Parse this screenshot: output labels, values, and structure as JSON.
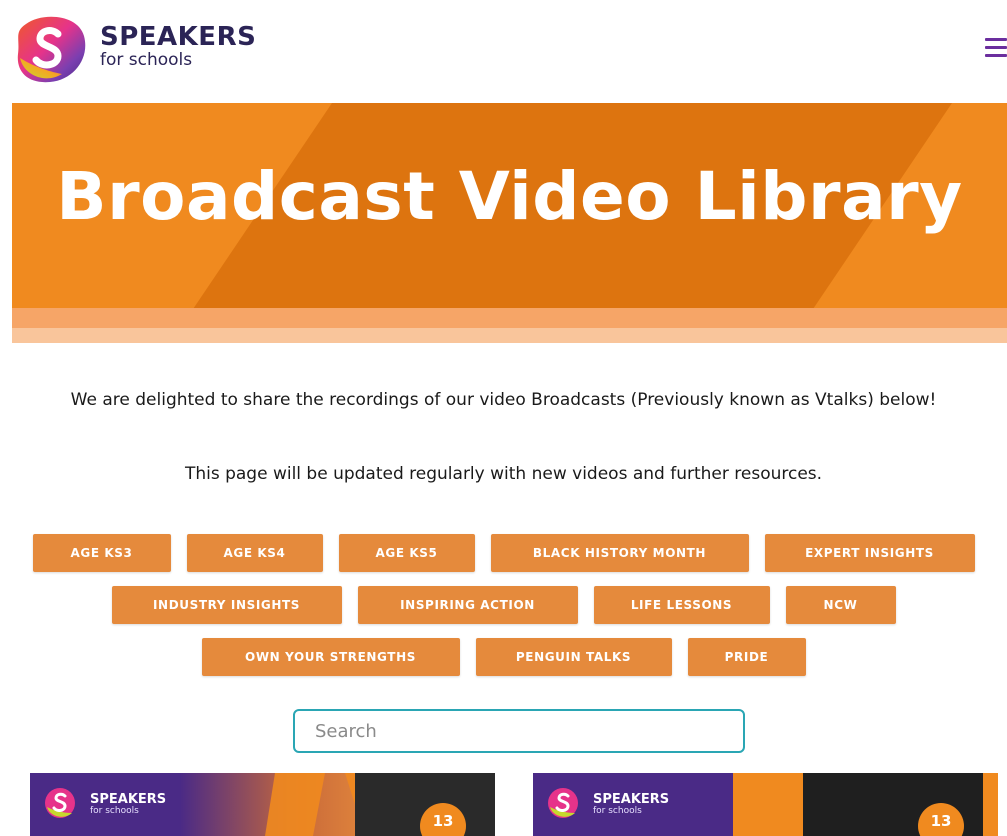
{
  "header": {
    "brand_top": "SPEAKERS",
    "brand_bottom": "for schools"
  },
  "hero": {
    "title": "Broadcast Video Library"
  },
  "intro": {
    "line1": "We are delighted to share the recordings of our video Broadcasts (Previously known as Vtalks) below!",
    "line2": "This page will be updated regularly with new videos and further resources."
  },
  "filters": {
    "row1": [
      "AGE KS3",
      "AGE KS4",
      "AGE KS5",
      "BLACK HISTORY MONTH",
      "EXPERT INSIGHTS"
    ],
    "row2": [
      "INDUSTRY INSIGHTS",
      "INSPIRING ACTION",
      "LIFE LESSONS",
      "NCW"
    ],
    "row3": [
      "OWN YOUR STRENGTHS",
      "PENGUIN TALKS",
      "PRIDE"
    ]
  },
  "search": {
    "placeholder": "Search"
  },
  "cards": [
    {
      "brand_top": "SPEAKERS",
      "brand_bottom": "for schools",
      "badge": "13"
    },
    {
      "brand_top": "SPEAKERS",
      "brand_bottom": "for schools",
      "badge": "13"
    }
  ],
  "colors": {
    "brand_purple": "#2b2456",
    "hero_orange": "#f08a1f",
    "hero_dark_orange": "#dd740f",
    "filter_orange": "#e58a3c",
    "search_border": "#2aa6b4",
    "card_purple": "#4a2a86"
  },
  "icons": {
    "logo": "speakers-logo-icon",
    "menu": "hamburger-menu-icon"
  }
}
